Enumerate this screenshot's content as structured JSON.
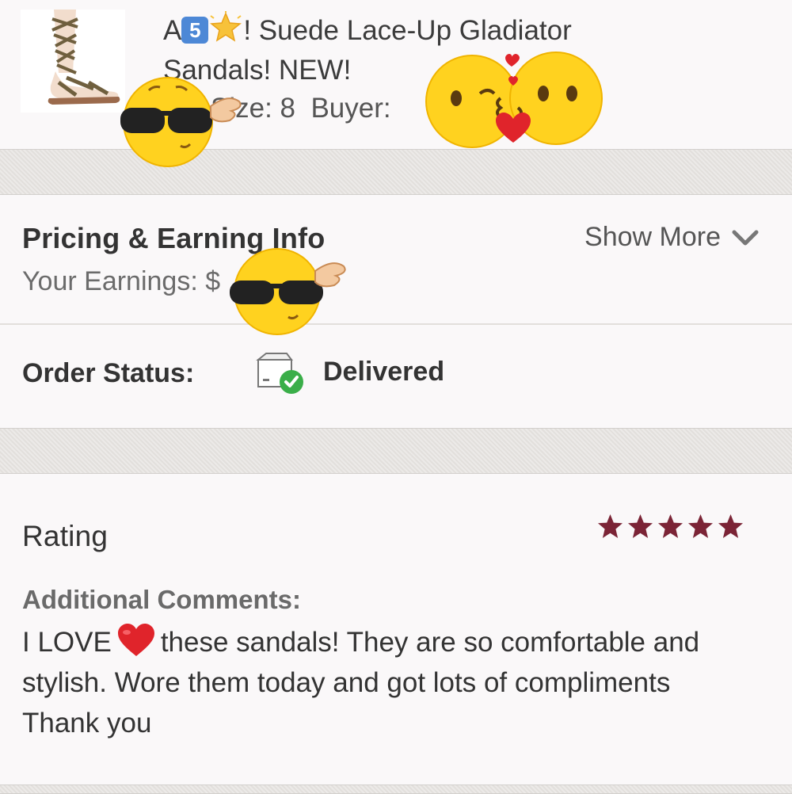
{
  "product": {
    "title_prefix": "A",
    "keycap_number": "5",
    "title_suffix": "! Suede Lace-Up Gladiator Sandals! NEW!",
    "size_label": "Size: 8",
    "buyer_label": "Buyer:"
  },
  "pricing": {
    "title": "Pricing & Earning Info",
    "show_more": "Show More",
    "earnings_label": "Your Earnings: $"
  },
  "order": {
    "status_label": "Order Status:",
    "status_value": "Delivered"
  },
  "rating": {
    "title": "Rating",
    "stars": 5,
    "max_stars": 5,
    "comments_label": "Additional Comments:",
    "comment_before_heart": "I LOVE",
    "comment_after_heart": "these sandals! They are so comfortable and stylish. Wore them today and got lots of compliments Thank you"
  },
  "icons": {
    "keycap": "keycap-5-icon",
    "star_emoji": "glowing-star-icon",
    "heart": "red-heart-icon",
    "delivered": "package-check-icon",
    "chevron": "chevron-down-icon",
    "rating_star": "star-icon",
    "sunglasses_sticker": "sunglasses-face-sticker",
    "kiss_sticker": "kissing-faces-sticker"
  },
  "colors": {
    "star": "#7b2436",
    "check_green": "#3aae49",
    "divider": "#e6e3e0",
    "heart": "#e0242b"
  }
}
